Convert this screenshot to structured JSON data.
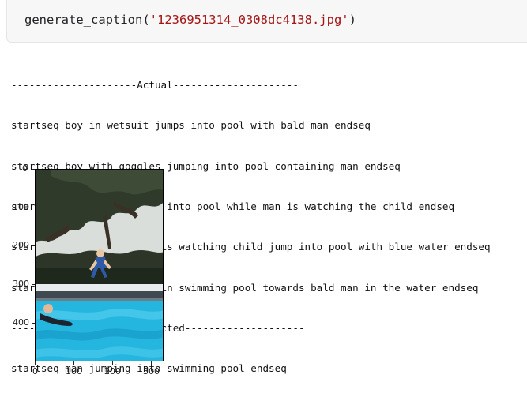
{
  "code_cell": {
    "function_name": "generate_caption",
    "open_paren": "(",
    "argument": "'1236951314_0308dc4138.jpg'",
    "close_paren": ")"
  },
  "output": {
    "lines": [
      "---------------------Actual---------------------",
      "startseq boy in wetsuit jumps into pool with bald man endseq",
      "startseq boy with goggles jumping into pool containing man endseq",
      "startseq child is jumping into pool while man is watching the child endseq",
      "startseq swimming person is watching child jump into pool with blue water endseq",
      "startseq young boy jumps in swimming pool towards bald man in the water endseq",
      "--------------------Predicted--------------------",
      "startseq man jumping into swimming pool endseq"
    ]
  },
  "image_plot": {
    "y_ticks": [
      "0",
      "100",
      "200",
      "300",
      "400"
    ],
    "x_ticks": [
      "0",
      "100",
      "200",
      "300"
    ]
  }
}
